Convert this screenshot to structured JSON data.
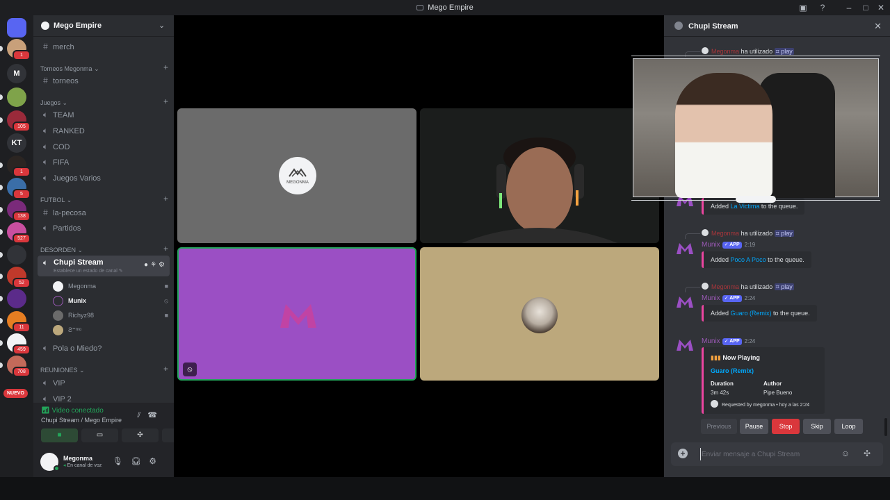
{
  "window": {
    "title": "Mego Empire"
  },
  "guilds": [
    {
      "label": "",
      "badge": "",
      "color": "#5865f2",
      "icon": "discord-icon"
    },
    {
      "label": "",
      "badge": "1",
      "color": "#c8a07a",
      "icon": "avatar"
    },
    {
      "label": "M",
      "badge": "",
      "color": "#313338"
    },
    {
      "label": "",
      "badge": "",
      "color": "#7fa34a"
    },
    {
      "label": "",
      "badge": "105",
      "color": "#9a2a3a"
    },
    {
      "label": "KT",
      "badge": "",
      "color": "#313338"
    },
    {
      "label": "",
      "badge": "1",
      "color": "#2b2522"
    },
    {
      "label": "",
      "badge": "5",
      "color": "#3a6ea8"
    },
    {
      "label": "",
      "badge": "138",
      "color": "#7a2a7a"
    },
    {
      "label": "",
      "badge": "527",
      "color": "#c94fa0"
    },
    {
      "label": "",
      "badge": "",
      "color": "#313338"
    },
    {
      "label": "",
      "badge": "52",
      "color": "#c0392b"
    },
    {
      "label": "",
      "badge": "",
      "color": "#5b2b8a"
    },
    {
      "label": "",
      "badge": "11",
      "color": "#e67e22"
    },
    {
      "label": "",
      "badge": "459",
      "color": "#f2f3f5"
    },
    {
      "label": "",
      "badge": "708",
      "color": "#c46a5a"
    }
  ],
  "new_badge": "NUEVO",
  "server": {
    "name": "Mego Empire"
  },
  "channels": {
    "merch": "merch",
    "cat_torneos": "Torneos Megonma",
    "torneos": "torneos",
    "cat_juegos": "Juegos",
    "team": "TEAM",
    "ranked": "RANKED",
    "cod": "COD",
    "fifa": "FIFA",
    "juegos_varios": "Juegos Varios",
    "cat_futbol": "FUTBOL",
    "la_pecosa": "la-pecosa",
    "partidos": "Partidos",
    "cat_desorden": "DESORDEN",
    "chupi_stream": "Chupi Stream",
    "chupi_status": "Establece un estado de canal",
    "pola_o_miedo": "Pola o Miedo?",
    "cat_reuniones": "REUNIONES",
    "vip": "VIP",
    "vip2": "VIP 2"
  },
  "voice_users": [
    {
      "name": "Megonma",
      "right_icon": "camera-icon",
      "bold": false
    },
    {
      "name": "Munix",
      "right_icon": "deafened-icon",
      "bold": true
    },
    {
      "name": "Richyz98",
      "right_icon": "camera-icon",
      "bold": false
    },
    {
      "name": "",
      "right_icon": "",
      "bold": false
    }
  ],
  "voice_panel": {
    "status": "Video conectado",
    "channel": "Chupi Stream / Mego Empire"
  },
  "user_panel": {
    "name": "Megonma",
    "status": "En canal de voz"
  },
  "thread": {
    "title": "Chupi Stream",
    "used_text": "ha utilizado",
    "command": "play",
    "bot_name": "Munix",
    "app_tag": "APP",
    "messages": [
      {
        "user": "Megonma",
        "time": "",
        "queue": {
          "prefix": "Added ",
          "song": "La Victima",
          "suffix": " to the queue."
        }
      },
      {
        "user": "Megonma",
        "time": "2:19",
        "queue": {
          "prefix": "Added ",
          "song": "Poco A Poco",
          "suffix": " to the queue."
        }
      },
      {
        "user": "Megonma",
        "time": "2:24",
        "queue": {
          "prefix": "Added ",
          "song": "Guaro (Remix)",
          "suffix": " to the queue."
        }
      }
    ],
    "now_playing": {
      "time": "2:24",
      "title": "Now Playing",
      "song": "Guaro (Remix)",
      "duration_label": "Duration",
      "duration": "3m 42s",
      "author_label": "Author",
      "author": "Pipe Bueno",
      "requested_by": "Requested by megonma • hoy a las 2:24"
    },
    "controls": {
      "previous": "Previous",
      "pause": "Pause",
      "stop": "Stop",
      "skip": "Skip",
      "loop": "Loop"
    },
    "composer_placeholder": "Enviar mensaje a Chupi Stream"
  },
  "stage": {
    "tile1_label": "MEGONMA"
  },
  "colors": {
    "accent": "#5865f2",
    "danger": "#da373c",
    "online": "#23a55a",
    "tile_purple": "#9b4fc4",
    "tile_tan": "#bca87c"
  }
}
